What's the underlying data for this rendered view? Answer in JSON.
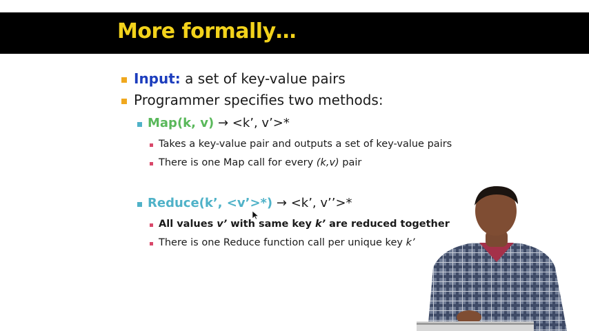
{
  "slide": {
    "title": "More formally…"
  },
  "bullets": {
    "input_label": "Input:",
    "input_text": " a set of key-value pairs",
    "programmer": "Programmer specifies two methods:",
    "map_sig": "Map(k, v)",
    "map_arrow": " → <k’, v’>*",
    "map_sub1": "Takes a key-value pair and outputs a set of key-value pairs",
    "map_sub2_pre": "There is one Map call for every ",
    "map_sub2_em": "(k,v)",
    "map_sub2_post": " pair",
    "reduce_sig": "Reduce(k’, <v’>*)",
    "reduce_arrow": " → <k’, v’’>*",
    "reduce_sub1_a": "All values ",
    "reduce_sub1_b": "v’",
    "reduce_sub1_c": " with same key ",
    "reduce_sub1_d": "k’",
    "reduce_sub1_e": " are reduced together",
    "reduce_sub2_pre": "There is one Reduce function call per unique key ",
    "reduce_sub2_em": "k’"
  },
  "colors": {
    "title": "#f2d21b",
    "title_band": "#000000",
    "input": "#1c3dbd",
    "map": "#59b85a",
    "reduce": "#4fb2c8",
    "bullet_l1": "#f0a81e",
    "bullet_l3": "#d9486a"
  }
}
